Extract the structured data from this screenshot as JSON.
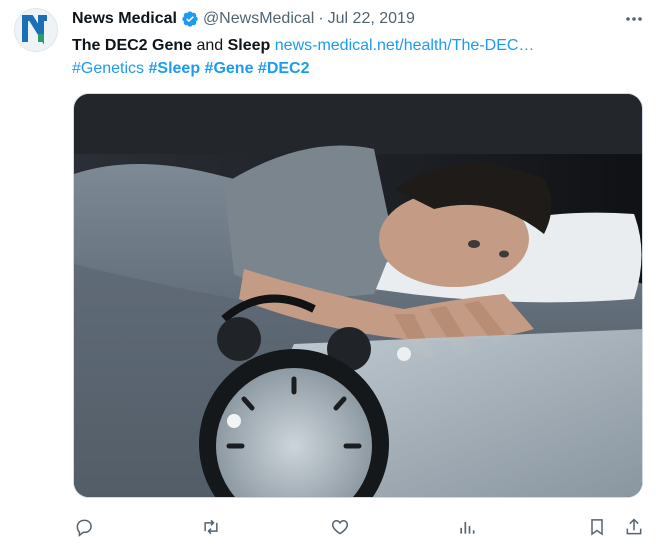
{
  "tweet": {
    "author_name": "News Medical",
    "author_handle": "@NewsMedical",
    "separator": "·",
    "date": "Jul 22, 2019",
    "avatar_letter": "N",
    "text": {
      "part1": "The DEC2 Gene",
      "part2": " and ",
      "part3": "Sleep",
      "link": "news-medical.net/health/The-DEC…",
      "hashtags": [
        "#Genetics",
        "#Sleep",
        "#Gene",
        "#DEC2"
      ]
    },
    "media_alt": "Man lying awake in bed looking at an alarm clock"
  },
  "colors": {
    "accent": "#1d9bf0",
    "text": "#0f1419",
    "muted": "#536471",
    "avatar_blue": "#1a6fb5",
    "avatar_green": "#2a9d6f"
  },
  "icons": {
    "verified": "verified-badge-icon",
    "more": "more-dots-icon",
    "reply": "reply-icon",
    "retweet": "retweet-icon",
    "like": "like-icon",
    "views": "views-icon",
    "bookmark": "bookmark-icon",
    "share": "share-icon"
  }
}
